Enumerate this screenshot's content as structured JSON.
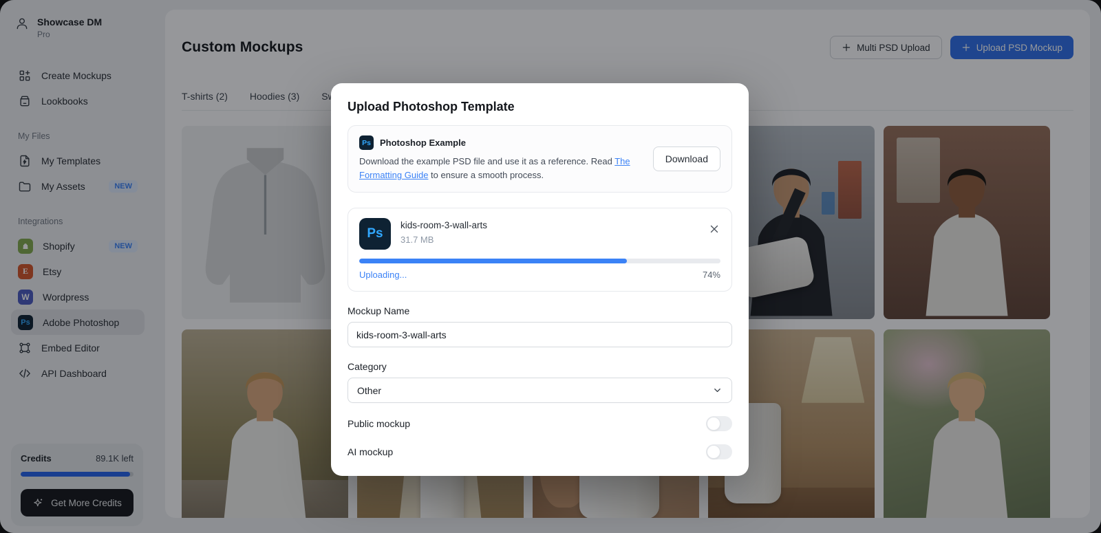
{
  "app": {
    "name": "Showcase DM",
    "plan": "Pro"
  },
  "sidebar": {
    "nav": [
      {
        "label": "Create Mockups",
        "icon": "create-mockups-icon"
      },
      {
        "label": "Lookbooks",
        "icon": "lookbooks-icon"
      }
    ],
    "sections": [
      {
        "title": "My Files",
        "items": [
          {
            "label": "My Templates",
            "icon": "template-file-icon"
          },
          {
            "label": "My Assets",
            "icon": "folder-icon",
            "badge": "NEW"
          }
        ]
      },
      {
        "title": "Integrations",
        "items": [
          {
            "label": "Shopify",
            "icon": "shopify-icon",
            "badge": "NEW"
          },
          {
            "label": "Etsy",
            "icon": "etsy-icon",
            "glyph": "E"
          },
          {
            "label": "Wordpress",
            "icon": "wordpress-icon",
            "glyph": "W"
          },
          {
            "label": "Adobe Photoshop",
            "icon": "photoshop-icon",
            "glyph": "Ps",
            "active": true
          },
          {
            "label": "Embed Editor",
            "icon": "embed-editor-icon"
          },
          {
            "label": "API Dashboard",
            "icon": "code-icon"
          }
        ]
      }
    ],
    "credits": {
      "label": "Credits",
      "remaining": "89.1K left",
      "progress": 97,
      "button": "Get More Credits"
    }
  },
  "main": {
    "title": "Custom Mockups",
    "buttons": {
      "multi": "Multi PSD Upload",
      "upload": "Upload PSD Mockup"
    },
    "tabs": [
      {
        "label": "T-shirts (2)"
      },
      {
        "label": "Hoodies (3)"
      },
      {
        "label": "Sw"
      }
    ]
  },
  "modal": {
    "title": "Upload Photoshop Template",
    "example": {
      "icon_glyph": "Ps",
      "title": "Photoshop Example",
      "desc_1": "Download the example PSD file and use it as a reference. Read",
      "link": "The Formatting Guide",
      "desc_2": " to ensure a smooth process.",
      "button": "Download"
    },
    "upload": {
      "icon_glyph": "Ps",
      "filename": "kids-room-3-wall-arts",
      "size": "31.7 MB",
      "status": "Uploading...",
      "percent_label": "74%",
      "progress": 74
    },
    "form": {
      "name_label": "Mockup Name",
      "name_value": "kids-room-3-wall-arts",
      "category_label": "Category",
      "category_value": "Other",
      "toggles": [
        {
          "label": "Public mockup",
          "on": false
        },
        {
          "label": "AI mockup",
          "on": false
        }
      ]
    }
  },
  "colors": {
    "accent": "#2f6fe8",
    "link": "#3b82f6",
    "ps_bg": "#0e2233",
    "ps_text": "#31a8ff",
    "credits_bar": "#2563eb"
  }
}
